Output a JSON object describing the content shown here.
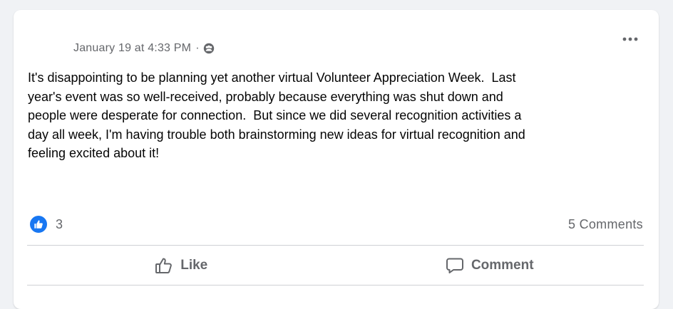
{
  "post": {
    "timestamp": "January 19 at 4:33 PM",
    "separator": "·",
    "audience_icon": "group-members-icon",
    "more_icon": "more-options-icon",
    "text": "It's disappointing to be planning yet another virtual Volunteer Appreciation Week.  Last\nyear's event was so well-received, probably because everything was shut down and\npeople were desperate for connection.  But since we did several recognition activities a\nday all week, I'm having trouble both brainstorming new ideas for virtual recognition and\nfeeling excited about it!"
  },
  "stats": {
    "reaction_icon": "like-reaction-icon",
    "reaction_count": "3",
    "comments_label": "5 Comments"
  },
  "actions": {
    "like_label": "Like",
    "comment_label": "Comment"
  },
  "colors": {
    "background": "#f0f2f5",
    "card": "#ffffff",
    "text": "#050505",
    "secondary_text": "#65676b",
    "like_blue": "#1877f2",
    "divider": "#ced0d4"
  }
}
